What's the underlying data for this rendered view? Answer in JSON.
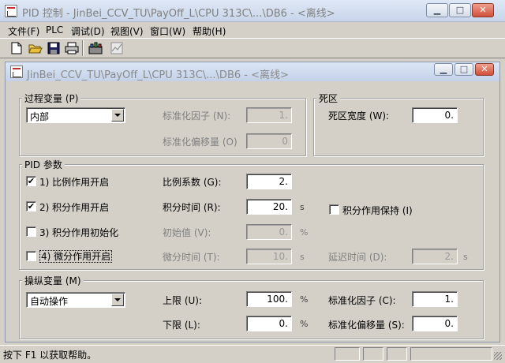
{
  "app": {
    "title": "PID 控制 - JinBei_CCV_TU\\PayOff_L\\CPU 313C\\...\\DB6 - <离线>",
    "controls": {
      "minimize": "▁",
      "maximize": "□",
      "close": "✕"
    }
  },
  "menu": [
    {
      "label": "文件(F)"
    },
    {
      "label": "PLC"
    },
    {
      "label": "调试(D)"
    },
    {
      "label": "视图(V)"
    },
    {
      "label": "窗口(W)"
    },
    {
      "label": "帮助(H)"
    }
  ],
  "toolbar": {
    "icons": [
      "new-file-icon",
      "open-folder-icon",
      "save-icon",
      "print-icon",
      "plc-download-icon",
      "chart-icon"
    ]
  },
  "inner_window": {
    "title": "JinBei_CCV_TU\\PayOff_L\\CPU 313C\\...\\DB6 - <离线>"
  },
  "process_variable": {
    "title": "过程变量 (P)",
    "source": "内部",
    "norm_factor_label": "标准化因子 (N):",
    "norm_factor": "1.",
    "norm_offset_label": "标准化偏移量 (O)",
    "norm_offset": "0"
  },
  "deadband": {
    "title": "死区",
    "width_label": "死区宽度 (W):",
    "width": "0."
  },
  "pid": {
    "title": "PID 参数",
    "p_enable_label": "1) 比例作用开启",
    "p_enable_checked": true,
    "gain_label": "比例系数 (G):",
    "gain": "2.",
    "i_enable_label": "2) 积分作用开启",
    "i_enable_checked": true,
    "ti_label": "积分时间 (R):",
    "ti": "20.",
    "ti_unit": "s",
    "i_hold_label": "积分作用保持 (I)",
    "i_hold_checked": false,
    "i_init_label": "3) 积分作用初始化",
    "i_init_checked": false,
    "i_init_value_label": "初始值 (V):",
    "i_init_value": "0.",
    "i_init_unit": "%",
    "d_enable_label": "4) 微分作用开启",
    "d_enable_checked": false,
    "td_label": "微分时间 (T):",
    "td": "10.",
    "td_unit": "s",
    "delay_label": "延迟时间 (D):",
    "delay": "2.",
    "delay_unit": "s"
  },
  "manipulated_variable": {
    "title": "操纵变量 (M)",
    "mode": "自动操作",
    "upper_label": "上限 (U):",
    "upper": "100.",
    "upper_unit": "%",
    "lower_label": "下限 (L):",
    "lower": "0.",
    "lower_unit": "%",
    "norm_factor_label": "标准化因子 (C):",
    "norm_factor": "1.",
    "norm_offset_label": "标准化偏移量 (S):",
    "norm_offset": "0."
  },
  "status": {
    "text": "按下 F1 以获取帮助。"
  }
}
